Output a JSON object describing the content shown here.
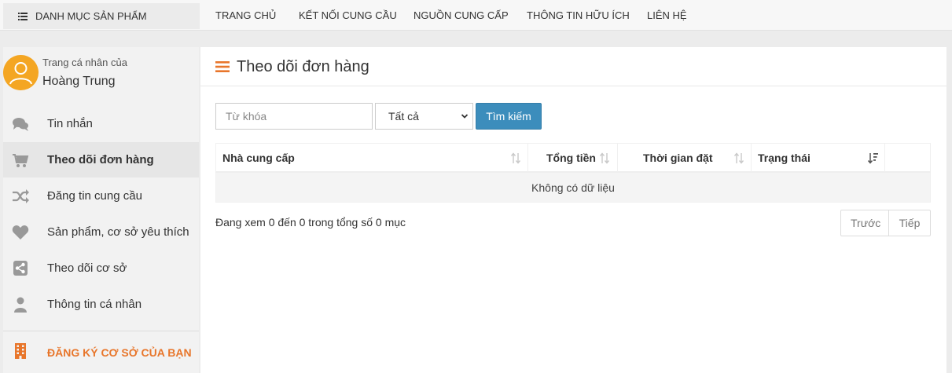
{
  "topnav": {
    "category_label": "DANH MỤC SẢN PHẨM",
    "items": [
      "TRANG CHỦ",
      "KẾT NỐI CUNG CẦU",
      "NGUỒN CUNG CẤP",
      "THÔNG TIN HỮU ÍCH",
      "LIÊN HỆ"
    ]
  },
  "profile": {
    "caption": "Trang cá nhân của",
    "name": "Hoàng Trung"
  },
  "sidebar": {
    "items": [
      {
        "label": "Tin nhắn",
        "icon": "chat-icon"
      },
      {
        "label": "Theo dõi đơn hàng",
        "icon": "cart-icon",
        "active": true
      },
      {
        "label": "Đăng tin cung cầu",
        "icon": "shuffle-icon"
      },
      {
        "label": "Sản phẩm, cơ sở yêu thích",
        "icon": "heart-icon"
      },
      {
        "label": "Theo dõi cơ sở",
        "icon": "share-icon"
      },
      {
        "label": "Thông tin cá nhân",
        "icon": "user-icon"
      }
    ],
    "register_label": "ĐĂNG KÝ CƠ SỞ CỦA BẠN"
  },
  "main": {
    "title": "Theo dõi đơn hàng",
    "search": {
      "keyword_placeholder": "Từ khóa",
      "status_selected": "Tất cả",
      "button_label": "Tìm kiếm"
    },
    "table": {
      "columns": [
        "Nhà cung cấp",
        "Tổng tiền",
        "Thời gian đặt",
        "Trạng thái",
        ""
      ],
      "empty_text": "Không có dữ liệu"
    },
    "info_text": "Đang xem 0 đến 0 trong tổng số 0 mục",
    "pager": {
      "prev": "Trước",
      "next": "Tiếp"
    }
  },
  "colors": {
    "accent": "#e8762b",
    "button": "#3c8dbc",
    "icon_gray": "#999999"
  }
}
